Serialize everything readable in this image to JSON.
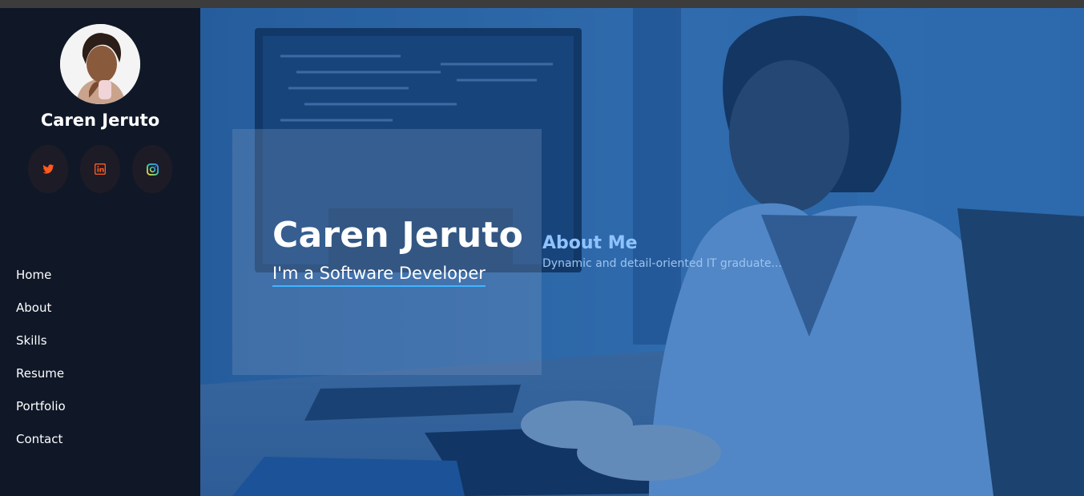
{
  "profile": {
    "name": "Caren Jeruto"
  },
  "socials": [
    {
      "icon": "twitter-icon",
      "color": "#ff5a1f"
    },
    {
      "icon": "linkedin-icon",
      "color": "#ff5a1f"
    },
    {
      "icon": "instagram-icon",
      "color": "#2fd1a8"
    }
  ],
  "nav": {
    "items": [
      {
        "label": "Home"
      },
      {
        "label": "About"
      },
      {
        "label": "Skills"
      },
      {
        "label": "Resume"
      },
      {
        "label": "Portfolio"
      },
      {
        "label": "Contact"
      }
    ]
  },
  "hero": {
    "name": "Caren Jeruto",
    "role": "I'm a Software Developer",
    "accent": "#3fb6ff"
  },
  "about": {
    "title": "About Me",
    "text": "Dynamic and detail-oriented IT graduate..."
  },
  "colors": {
    "sidebar_bg": "#101828",
    "hero_tint": "#1f5690"
  }
}
